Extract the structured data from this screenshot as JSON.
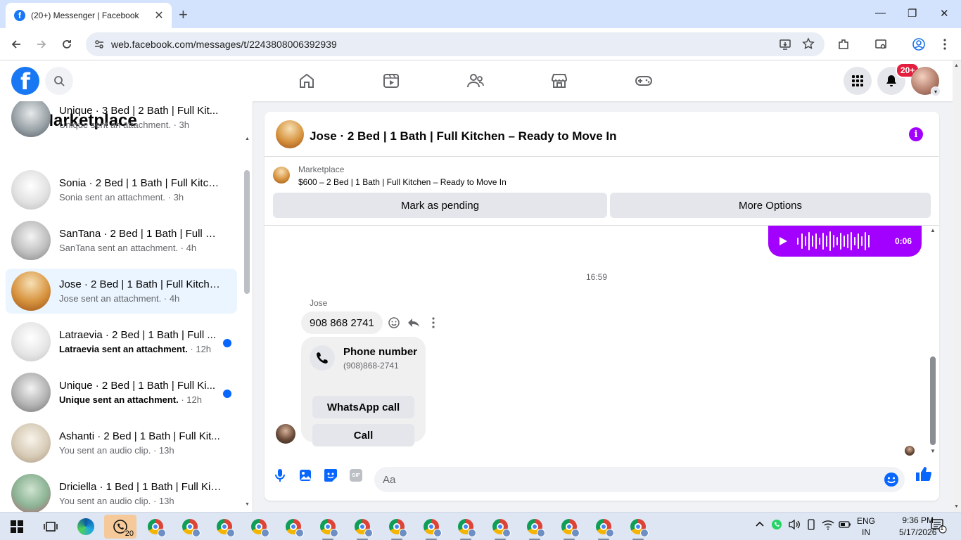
{
  "browser": {
    "tab_title": "(20+) Messenger | Facebook",
    "tab_favicon": "f",
    "url": "web.facebook.com/messages/t/2243808006392939"
  },
  "fb_header": {
    "logo": "f",
    "notifications_badge": "20+"
  },
  "sidebar": {
    "title": "Marketplace",
    "conversations": [
      {
        "name": "Unique · 3 Bed | 2 Bath | Full Kit...",
        "preview": "Unique sent an attachment.",
        "time": " · 3h",
        "unread": false,
        "active": false
      },
      {
        "name": "Sonia · 2 Bed | 1 Bath | Full Kitch...",
        "preview": "Sonia sent an attachment.",
        "time": " · 3h",
        "unread": false,
        "active": false
      },
      {
        "name": "SanTana · 2 Bed | 1 Bath | Full Kit...",
        "preview": "SanTana sent an attachment.",
        "time": " · 4h",
        "unread": false,
        "active": false
      },
      {
        "name": "Jose · 2 Bed | 1 Bath | Full Kitche...",
        "preview": "Jose sent an attachment.",
        "time": " · 4h",
        "unread": false,
        "active": true
      },
      {
        "name": "Latraevia · 2 Bed | 1 Bath | Full ...",
        "preview": "Latraevia sent an attachment.",
        "time": " · 12h",
        "unread": true,
        "active": false
      },
      {
        "name": "Unique · 2 Bed | 1 Bath | Full Ki...",
        "preview": "Unique sent an attachment.",
        "time": " · 12h",
        "unread": true,
        "active": false
      },
      {
        "name": "Ashanti · 2 Bed | 1 Bath | Full Kit...",
        "preview": "You sent an audio clip.",
        "time": " · 13h",
        "unread": false,
        "active": false
      },
      {
        "name": "Driciella · 1 Bed | 1 Bath | Full Kit...",
        "preview": "You sent an audio clip.",
        "time": " · 13h",
        "unread": false,
        "active": false
      }
    ]
  },
  "chat": {
    "header_name": "Jose · 2 Bed | 1 Bath | Full Kitchen – Ready to Move In",
    "marketplace_label": "Marketplace",
    "listing_title": "$600 – 2 Bed | 1 Bath | Full Kitchen – Ready to Move In",
    "mark_pending": "Mark as pending",
    "more_options": "More Options",
    "audio_duration": "0:06",
    "time_separator": "16:59",
    "sender": "Jose",
    "message": "908 868 2741",
    "phone_card": {
      "title": "Phone number",
      "number": "(908)868-2741",
      "whatsapp": "WhatsApp call",
      "call": "Call"
    },
    "input_placeholder": "Aa",
    "gif_label": "GIF"
  },
  "taskbar": {
    "whatsapp_count": "20",
    "lang_top": "ENG",
    "lang_bottom": "IN",
    "time": "9:36 PM",
    "date": "5/17/2026",
    "notif_count": "1"
  },
  "colors": {
    "accent": "#1877f2",
    "messenger_purple": "#a200ff",
    "badge_red": "#e41e3f",
    "active_row": "#ebf5ff"
  }
}
